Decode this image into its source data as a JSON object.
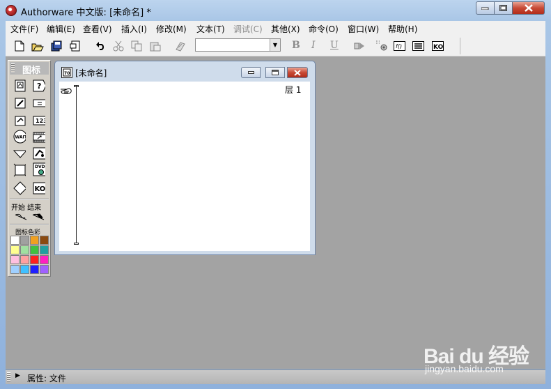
{
  "window": {
    "title": "Authorware 中文版: [未命名] *"
  },
  "menu": [
    {
      "label": "文件(F)",
      "disabled": false
    },
    {
      "label": "编辑(E)",
      "disabled": false
    },
    {
      "label": "查看(V)",
      "disabled": false
    },
    {
      "label": "插入(I)",
      "disabled": false
    },
    {
      "label": "修改(M)",
      "disabled": false
    },
    {
      "label": "文本(T)",
      "disabled": false
    },
    {
      "label": "调试(C)",
      "disabled": true
    },
    {
      "label": "其他(X)",
      "disabled": false
    },
    {
      "label": "命令(O)",
      "disabled": false
    },
    {
      "label": "窗口(W)",
      "disabled": false
    },
    {
      "label": "帮助(H)",
      "disabled": false
    }
  ],
  "toolbar": {
    "font_combo_value": "",
    "format": {
      "bold": "B",
      "italic": "I",
      "underline": "U"
    },
    "icons": [
      "new-file-icon",
      "open-folder-icon",
      "save-all-icon",
      "import-icon",
      "undo-icon",
      "cut-icon",
      "copy-icon",
      "paste-icon",
      "find-icon",
      "bold-icon",
      "italic-icon",
      "underline-icon",
      "run-icon",
      "control-panel-icon",
      "functions-icon",
      "variables-icon",
      "knowledge-objects-icon"
    ]
  },
  "palette": {
    "title": "图标",
    "startend_label": "开始 结束",
    "color_label": "图标色彩",
    "icons": [
      {
        "name": "display-icon",
        "glyph": "▣"
      },
      {
        "name": "motion-icon",
        "glyph": "?"
      },
      {
        "name": "erase-icon",
        "glyph": "⬚"
      },
      {
        "name": "wait-icon",
        "glyph": "="
      },
      {
        "name": "navigate-icon",
        "glyph": "◇"
      },
      {
        "name": "interaction-icon",
        "glyph": "?"
      },
      {
        "name": "calculation-icon",
        "glyph": "="
      },
      {
        "name": "decision-icon",
        "glyph": "◇"
      },
      {
        "name": "framework-icon",
        "glyph": "▢"
      },
      {
        "name": "digital-movie-icon",
        "glyph": "▦"
      },
      {
        "name": "sound-icon",
        "glyph": "♪"
      },
      {
        "name": "video-icon",
        "glyph": "DVD"
      },
      {
        "name": "ko-icon",
        "glyph": "KO"
      }
    ],
    "colors": [
      "#ffffff",
      "#a0a0a0",
      "#f0a020",
      "#8a4a10",
      "#ffff90",
      "#a0e0a0",
      "#40c040",
      "#20a0a0",
      "#ffc0e0",
      "#ffa0a0",
      "#ff2020",
      "#ff20c0",
      "#a0d0ff",
      "#40c0ff",
      "#2020ff",
      "#a060ff"
    ]
  },
  "design_window": {
    "title": "[未命名]",
    "layer_label": "层 1"
  },
  "properties_bar": {
    "label": "属性: 文件"
  },
  "watermark": {
    "logo": "Bai du 经验",
    "url": "jingyan.baidu.com"
  }
}
